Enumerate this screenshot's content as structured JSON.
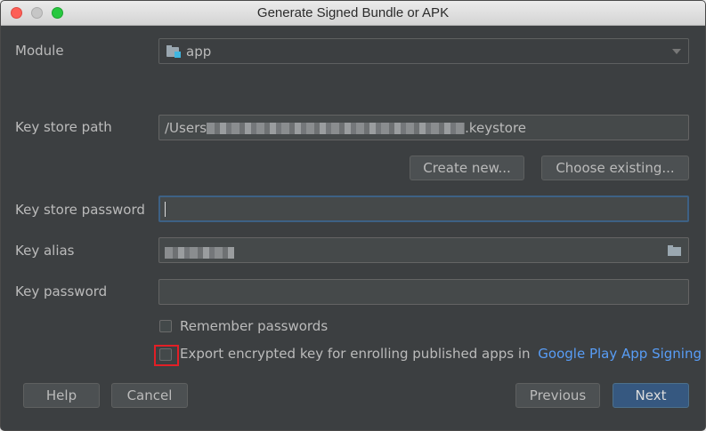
{
  "window": {
    "title": "Generate Signed Bundle or APK"
  },
  "module": {
    "label": "Module",
    "value": "app",
    "icon": "module-folder-icon"
  },
  "key_store_path": {
    "label": "Key store path",
    "prefix": "/Users",
    "suffix": ".keystore"
  },
  "buttons": {
    "create_new": "Create new...",
    "choose_existing": "Choose existing...",
    "help": "Help",
    "cancel": "Cancel",
    "previous": "Previous",
    "next": "Next"
  },
  "key_store_password": {
    "label": "Key store password",
    "value": ""
  },
  "key_alias": {
    "label": "Key alias"
  },
  "key_password": {
    "label": "Key password",
    "value": ""
  },
  "checkboxes": {
    "remember": {
      "label": "Remember passwords",
      "checked": false
    },
    "export": {
      "label": "Export encrypted key for enrolling published apps in",
      "link": "Google Play App Signing",
      "checked": false
    }
  },
  "colors": {
    "background": "#3c3f41",
    "primary_button": "#365880",
    "link": "#589df6",
    "highlight": "#e21f26"
  }
}
